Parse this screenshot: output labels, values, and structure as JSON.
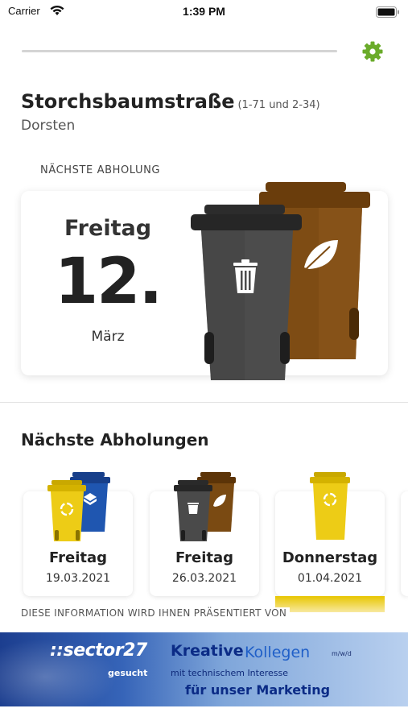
{
  "status_bar": {
    "carrier": "Carrier",
    "time": "1:39 PM"
  },
  "header": {
    "settings_icon": "gear-icon"
  },
  "location": {
    "street": "Storchsbaumstraße",
    "range": "(1-71 und 2-34)",
    "city": "Dorsten"
  },
  "next_pickup": {
    "section_label": "NÄCHSTE ABHOLUNG",
    "weekday": "Freitag",
    "day": "12.",
    "month": "März",
    "bins": [
      "residual-waste-bin",
      "organic-waste-bin"
    ]
  },
  "upcoming": {
    "title": "Nächste Abholungen",
    "items": [
      {
        "weekday": "Freitag",
        "date": "19.03.2021",
        "bins": [
          "yellow-recycling-bin",
          "blue-paper-bin"
        ]
      },
      {
        "weekday": "Freitag",
        "date": "26.03.2021",
        "bins": [
          "residual-waste-bin",
          "organic-waste-bin"
        ]
      },
      {
        "weekday": "Donnerstag",
        "date": "01.04.2021",
        "bins": [
          "yellow-recycling-bin"
        ]
      }
    ]
  },
  "sponsor": {
    "label": "DIESE INFORMATION WIRD IHNEN PRÄSENTIERT VON",
    "brand": "::sector27",
    "headline_1": "Kreative",
    "headline_2": "Kollegen",
    "small": "m/w/d",
    "line_2a": "gesucht",
    "line_2b": "mit technischem Interesse",
    "line_3": "für unser Marketing"
  },
  "colors": {
    "accent_green": "#6aab2a",
    "bin_grey": "#4a4a4a",
    "bin_brown": "#7a4a12",
    "bin_yellow": "#e8c600",
    "bin_blue": "#1f56b0"
  }
}
